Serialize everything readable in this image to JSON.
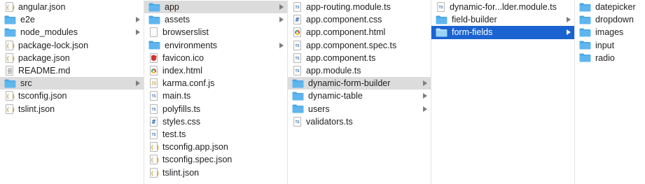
{
  "columns": [
    {
      "items": [
        {
          "name": "angular.json",
          "kind": "file",
          "icon": "json-file-icon",
          "glyph": "{ }"
        },
        {
          "name": "e2e",
          "kind": "folder",
          "icon": "folder-icon",
          "arrow": true
        },
        {
          "name": "node_modules",
          "kind": "folder",
          "icon": "folder-icon",
          "arrow": true
        },
        {
          "name": "package-lock.json",
          "kind": "file",
          "icon": "json-file-icon",
          "glyph": "{ }"
        },
        {
          "name": "package.json",
          "kind": "file",
          "icon": "json-file-icon",
          "glyph": "{ }"
        },
        {
          "name": "README.md",
          "kind": "file",
          "icon": "markdown-file-icon"
        },
        {
          "name": "src",
          "kind": "folder",
          "icon": "folder-icon",
          "arrow": true,
          "state": "selected"
        },
        {
          "name": "tsconfig.json",
          "kind": "file",
          "icon": "json-file-icon",
          "glyph": "{ }"
        },
        {
          "name": "tslint.json",
          "kind": "file",
          "icon": "json-file-icon",
          "glyph": "{ }"
        }
      ]
    },
    {
      "items": [
        {
          "name": "app",
          "kind": "folder",
          "icon": "folder-icon",
          "arrow": true,
          "state": "selected"
        },
        {
          "name": "assets",
          "kind": "folder",
          "icon": "folder-icon",
          "arrow": true
        },
        {
          "name": "browserslist",
          "kind": "file",
          "icon": "plain-file-icon"
        },
        {
          "name": "environments",
          "kind": "folder",
          "icon": "folder-icon",
          "arrow": true
        },
        {
          "name": "favicon.ico",
          "kind": "file",
          "icon": "angular-favicon-icon"
        },
        {
          "name": "index.html",
          "kind": "file",
          "icon": "html-file-icon"
        },
        {
          "name": "karma.conf.js",
          "kind": "file",
          "icon": "js-file-icon",
          "glyph": "JS"
        },
        {
          "name": "main.ts",
          "kind": "file",
          "icon": "ts-file-icon",
          "glyph": "TS"
        },
        {
          "name": "polyfills.ts",
          "kind": "file",
          "icon": "ts-file-icon",
          "glyph": "TS"
        },
        {
          "name": "styles.css",
          "kind": "file",
          "icon": "css-file-icon",
          "glyph": "#"
        },
        {
          "name": "test.ts",
          "kind": "file",
          "icon": "ts-file-icon",
          "glyph": "TS"
        },
        {
          "name": "tsconfig.app.json",
          "kind": "file",
          "icon": "json-file-icon",
          "glyph": "{ }"
        },
        {
          "name": "tsconfig.spec.json",
          "kind": "file",
          "icon": "json-file-icon",
          "glyph": "{ }"
        },
        {
          "name": "tslint.json",
          "kind": "file",
          "icon": "json-file-icon",
          "glyph": "{ }"
        }
      ]
    },
    {
      "items": [
        {
          "name": "app-routing.module.ts",
          "kind": "file",
          "icon": "ts-file-icon",
          "glyph": "TS"
        },
        {
          "name": "app.component.css",
          "kind": "file",
          "icon": "css-file-icon",
          "glyph": "#"
        },
        {
          "name": "app.component.html",
          "kind": "file",
          "icon": "html-file-icon"
        },
        {
          "name": "app.component.spec.ts",
          "kind": "file",
          "icon": "ts-file-icon",
          "glyph": "TS"
        },
        {
          "name": "app.component.ts",
          "kind": "file",
          "icon": "ts-file-icon",
          "glyph": "TS"
        },
        {
          "name": "app.module.ts",
          "kind": "file",
          "icon": "ts-file-icon",
          "glyph": "TS"
        },
        {
          "name": "dynamic-form-builder",
          "kind": "folder",
          "icon": "folder-icon",
          "arrow": true,
          "state": "selected"
        },
        {
          "name": "dynamic-table",
          "kind": "folder",
          "icon": "folder-icon",
          "arrow": true
        },
        {
          "name": "users",
          "kind": "folder",
          "icon": "folder-icon",
          "arrow": true
        },
        {
          "name": "validators.ts",
          "kind": "file",
          "icon": "ts-file-icon",
          "glyph": "TS"
        }
      ]
    },
    {
      "items": [
        {
          "name": "dynamic-for...lder.module.ts",
          "kind": "file",
          "icon": "ts-file-icon",
          "glyph": "TS"
        },
        {
          "name": "field-builder",
          "kind": "folder",
          "icon": "folder-icon",
          "arrow": true
        },
        {
          "name": "form-fields",
          "kind": "folder",
          "icon": "folder-icon",
          "arrow": true,
          "state": "active"
        }
      ]
    },
    {
      "items": [
        {
          "name": "datepicker",
          "kind": "folder",
          "icon": "folder-icon"
        },
        {
          "name": "dropdown",
          "kind": "folder",
          "icon": "folder-icon"
        },
        {
          "name": "images",
          "kind": "folder",
          "icon": "folder-icon"
        },
        {
          "name": "input",
          "kind": "folder",
          "icon": "folder-icon"
        },
        {
          "name": "radio",
          "kind": "folder",
          "icon": "folder-icon"
        }
      ]
    }
  ],
  "colors": {
    "folder": "#5fb6ef",
    "folder_tab": "#4aa6e6",
    "selected_inactive": "#dcdcdc",
    "selected_active": "#1a63d1",
    "divider": "#e3e3e3"
  }
}
